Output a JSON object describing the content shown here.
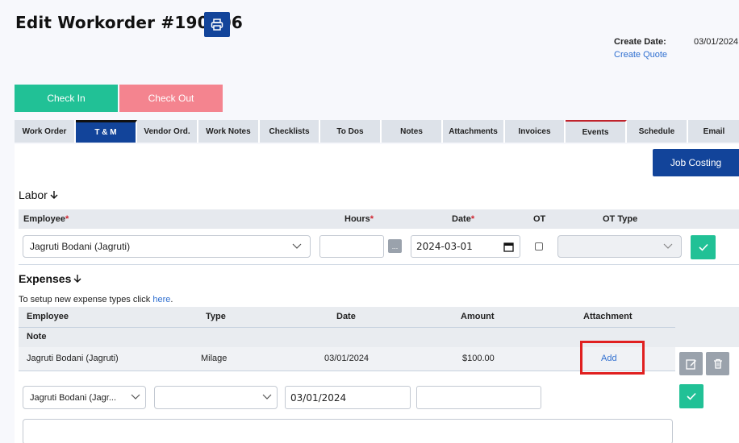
{
  "header": {
    "title": "Edit Workorder #190106",
    "create_date_label": "Create Date:",
    "create_date_value": "03/01/2024",
    "create_quote_link": "Create Quote"
  },
  "actions": {
    "check_in": "Check In",
    "check_out": "Check Out",
    "job_costing": "Job Costing"
  },
  "tabs": [
    {
      "label": "Work Order",
      "active": false
    },
    {
      "label": "T & M",
      "active": true
    },
    {
      "label": "Vendor Ord.",
      "active": false
    },
    {
      "label": "Work Notes",
      "active": false
    },
    {
      "label": "Checklists",
      "active": false
    },
    {
      "label": "To Dos",
      "active": false
    },
    {
      "label": "Notes",
      "active": false
    },
    {
      "label": "Attachments",
      "active": false
    },
    {
      "label": "Invoices",
      "active": false
    },
    {
      "label": "Events",
      "active": false
    },
    {
      "label": "Schedule",
      "active": false
    },
    {
      "label": "Email",
      "active": false
    }
  ],
  "labor": {
    "heading": "Labor",
    "columns": {
      "employee": "Employee",
      "hours": "Hours",
      "date": "Date",
      "ot": "OT",
      "ot_type": "OT Type",
      "required_mark": "*"
    },
    "form": {
      "employee_value": "Jagruti Bodani (Jagruti)",
      "hours_value": "",
      "dots_label": "...",
      "date_value": "2024-03-01",
      "ot_checked": false,
      "ot_type_value": ""
    }
  },
  "expenses": {
    "heading": "Expenses",
    "setup_text": "To setup new expense types click",
    "setup_link": "here",
    "setup_suffix": ".",
    "columns": {
      "employee": "Employee",
      "type": "Type",
      "date": "Date",
      "amount": "Amount",
      "attachment": "Attachment",
      "note": "Note"
    },
    "rows": [
      {
        "employee": "Jagruti Bodani (Jagruti)",
        "type": "Milage",
        "date": "03/01/2024",
        "amount": "$100.00",
        "attachment_action": "Add"
      }
    ],
    "form": {
      "employee_value": "Jagruti Bodani (Jagr...",
      "type_value": "",
      "date_value": "03/01/2024",
      "amount_value": ""
    }
  },
  "colors": {
    "primary": "#12449a",
    "success": "#21c196",
    "danger_soft": "#f4848f",
    "highlight": "#e02020"
  }
}
